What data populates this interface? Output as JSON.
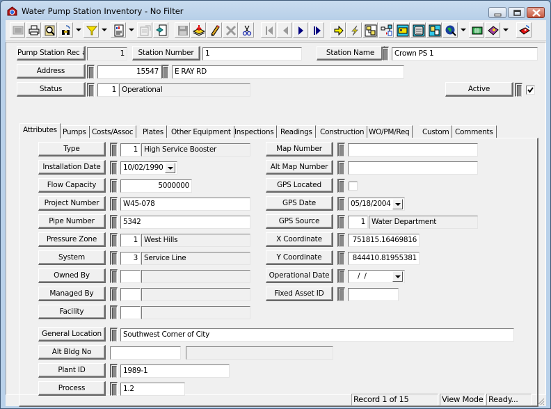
{
  "window": {
    "title": "Water Pump Station Inventory - No Filter",
    "app_icon": "pump-station-icon",
    "controls": [
      "minimize",
      "maximize",
      "close"
    ]
  },
  "toolbar": {
    "buttons": [
      {
        "name": "form-view-button",
        "icon": "form-view-icon",
        "enabled": false
      },
      {
        "name": "print-button",
        "icon": "printer-icon",
        "enabled": true
      },
      {
        "name": "print-preview-button",
        "icon": "magnifier-icon",
        "enabled": true
      },
      {
        "name": "find-button",
        "icon": "binoculars-icon",
        "enabled": true,
        "dropdown": true
      },
      {
        "name": "filter-button",
        "icon": "funnel-icon",
        "enabled": true,
        "dropdown": true
      },
      {
        "name": "report-button",
        "icon": "report-icon",
        "enabled": true,
        "dropdown": true
      },
      {
        "name": "edit-properties-button",
        "icon": "properties-icon",
        "enabled": false
      },
      {
        "name": "export-button",
        "icon": "export-icon",
        "enabled": true
      },
      {
        "name": "save-button",
        "icon": "floppy-icon",
        "enabled": false
      },
      {
        "name": "add-record-button",
        "icon": "add-record-icon",
        "enabled": true
      },
      {
        "name": "edit-button",
        "icon": "pencil-icon",
        "enabled": true
      },
      {
        "name": "delete-button",
        "icon": "x-icon",
        "enabled": false
      },
      {
        "name": "cut-button",
        "icon": "scissors-icon",
        "enabled": true
      },
      {
        "name": "first-record-button",
        "icon": "first-icon",
        "enabled": false
      },
      {
        "name": "previous-record-button",
        "icon": "previous-icon",
        "enabled": false
      },
      {
        "name": "next-record-button",
        "icon": "next-icon",
        "enabled": true
      },
      {
        "name": "last-record-button",
        "icon": "last-icon",
        "enabled": true
      },
      {
        "name": "goto-button",
        "icon": "arrow-right-icon",
        "enabled": true
      },
      {
        "name": "quick-action-button",
        "icon": "lightning-icon",
        "enabled": true
      },
      {
        "name": "relationships-button",
        "icon": "relationships-icon",
        "enabled": true
      },
      {
        "name": "hierarchy-button",
        "icon": "hierarchy-icon",
        "enabled": true
      },
      {
        "name": "work-order-button",
        "icon": "equipment-icon",
        "enabled": true
      },
      {
        "name": "calculator-button",
        "icon": "calculator-icon",
        "enabled": true
      },
      {
        "name": "attachments-button",
        "icon": "documents-icon",
        "enabled": true
      },
      {
        "name": "map-button",
        "icon": "globe-icon",
        "enabled": true,
        "dropdown": true
      },
      {
        "name": "spreadsheet-button",
        "icon": "grid-icon",
        "enabled": true
      },
      {
        "name": "help-book-button",
        "icon": "book-icon",
        "enabled": true,
        "dropdown": true
      },
      {
        "name": "exit-button",
        "icon": "exit-icon",
        "enabled": true
      }
    ]
  },
  "header": {
    "rec_label": "Pump Station Rec #",
    "rec_value": "1",
    "station_number_label": "Station Number",
    "station_number_value": "1",
    "station_name_label": "Station Name",
    "station_name_value": "Crown PS 1",
    "address_label": "Address",
    "address_number": "15547",
    "address_street": "E RAY RD",
    "status_label": "Status",
    "status_code": "1",
    "status_desc": "Operational",
    "active_label": "Active",
    "active_checked": true
  },
  "tabs": [
    {
      "label": "Attributes",
      "active": true
    },
    {
      "label": "Pumps"
    },
    {
      "label": "Costs/Assoc"
    },
    {
      "label": "Plates"
    },
    {
      "label": "Other Equipment"
    },
    {
      "label": "Inspections"
    },
    {
      "label": "Readings"
    },
    {
      "label": "Construction"
    },
    {
      "label": "WO/PM/Req"
    },
    {
      "label": "Custom"
    },
    {
      "label": "Comments"
    }
  ],
  "attributes": {
    "type": {
      "label": "Type",
      "code": "1",
      "desc": "High Service Booster"
    },
    "installation_date": {
      "label": "Installation Date",
      "value": "10/02/1990"
    },
    "flow_capacity": {
      "label": "Flow Capacity",
      "value": "5000000"
    },
    "project_number": {
      "label": "Project Number",
      "value": "W45-078"
    },
    "pipe_number": {
      "label": "Pipe Number",
      "value": "5342"
    },
    "pressure_zone": {
      "label": "Pressure Zone",
      "code": "1",
      "desc": "West Hills"
    },
    "system": {
      "label": "System",
      "code": "3",
      "desc": "Service Line"
    },
    "owned_by": {
      "label": "Owned By",
      "code": "",
      "desc": ""
    },
    "managed_by": {
      "label": "Managed By",
      "code": "",
      "desc": ""
    },
    "facility": {
      "label": "Facility",
      "code": "",
      "desc": ""
    },
    "map_number": {
      "label": "Map Number",
      "value": ""
    },
    "alt_map_number": {
      "label": "Alt Map Number",
      "value": ""
    },
    "gps_located": {
      "label": "GPS Located",
      "checked": false
    },
    "gps_date": {
      "label": "GPS Date",
      "value": "05/18/2004"
    },
    "gps_source": {
      "label": "GPS Source",
      "code": "1",
      "desc": "Water Department"
    },
    "x_coordinate": {
      "label": "X Coordinate",
      "value": "751815.16469816"
    },
    "y_coordinate": {
      "label": "Y Coordinate",
      "value": "844410.81955381"
    },
    "operational_date": {
      "label": "Operational Date",
      "value": " /  /"
    },
    "fixed_asset_id": {
      "label": "Fixed Asset ID",
      "value": ""
    },
    "general_location": {
      "label": "General Location",
      "value": "Southwest Corner of City"
    },
    "alt_bldg_no": {
      "label": "Alt Bldg No",
      "value": "",
      "desc": ""
    },
    "plant_id": {
      "label": "Plant ID",
      "value": "1989-1"
    },
    "process": {
      "label": "Process",
      "value": "1.2"
    }
  },
  "statusbar": {
    "record": "Record 1 of 15",
    "mode": "View Mode",
    "state": "Ready..."
  }
}
